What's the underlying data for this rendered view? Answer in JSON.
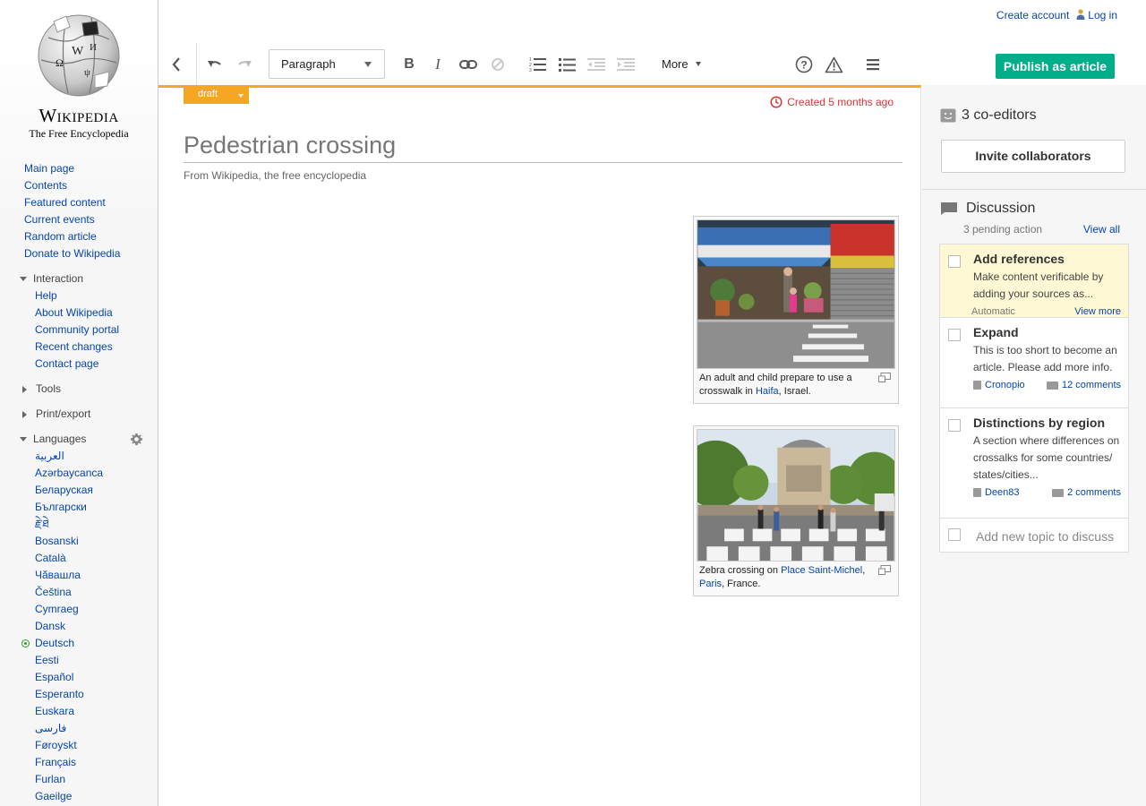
{
  "personal": {
    "create_account": "Create account",
    "log_in": "Log in"
  },
  "logo": {
    "wordmark": "Wikipedia",
    "tagline": "The Free Encyclopedia"
  },
  "nav": [
    "Main page",
    "Contents",
    "Featured content",
    "Current events",
    "Random article",
    "Donate to Wikipedia"
  ],
  "interaction": {
    "heading": "Interaction",
    "items": [
      "Help",
      "About Wikipedia",
      "Community portal",
      "Recent changes",
      "Contact page"
    ]
  },
  "tools_heading": "Tools",
  "print_heading": "Print/export",
  "languages": {
    "heading": "Languages",
    "items": [
      "العربية",
      "Azərbaycanca",
      "Беларуская",
      "Български",
      "རྗེ་ཐེ",
      "Bosanski",
      "Català",
      "Чӑвашла",
      "Čeština",
      "Cymraeg",
      "Dansk",
      "Deutsch",
      "Eesti",
      "Español",
      "Esperanto",
      "Euskara",
      "فارسی",
      "Føroyskt",
      "Français",
      "Furlan",
      "Gaeilge"
    ]
  },
  "toolbar": {
    "paragraph_label": "Paragraph",
    "more_label": "More",
    "publish_label": "Publish as article"
  },
  "article": {
    "status_badge": "draft",
    "created": "Created 5 months ago",
    "title": "Pedestrian crossing",
    "subtitle": "From Wikipedia, the free encyclopedia",
    "images": [
      {
        "caption_pre": "An adult and child prepare to use a crosswalk in ",
        "link1": "Haifa",
        "caption_post": ", Israel."
      },
      {
        "caption_pre": "Zebra crossing on ",
        "link1": "Place Saint-Michel",
        "mid": ", ",
        "link2": "Paris",
        "caption_post": ", France."
      }
    ]
  },
  "panel": {
    "coeditors": "3 co-editors",
    "invite_label": "Invite collaborators",
    "discussion_heading": "Discussion",
    "pending": "3 pending action",
    "view_all": "View all",
    "topics": [
      {
        "title": "Add references",
        "desc": "Make content verificable by adding your sources as...",
        "meta_left": "Automatic",
        "meta_right": "View more"
      },
      {
        "title": "Expand",
        "desc": "This is too short to become an article. Please add more info.",
        "meta_left": "Cronopio",
        "meta_right": "12 comments"
      },
      {
        "title": "Distinctions by region",
        "desc": "A section where differences on crossalks for some countries/ states/cities...",
        "meta_left": "Deen83",
        "meta_right": "2 comments"
      }
    ],
    "add_topic": "Add new topic to discuss"
  },
  "colors": {
    "accent_orange": "#f5a623",
    "publish_green": "#00af89",
    "link_blue": "#0645ad",
    "alert_red": "#d33"
  }
}
